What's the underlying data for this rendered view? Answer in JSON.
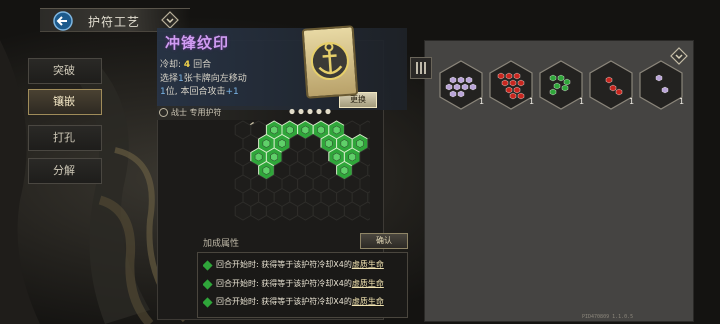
{
  "header": {
    "title": "护符工艺"
  },
  "menu": {
    "items": [
      {
        "label": "突破",
        "active": false
      },
      {
        "label": "镶嵌",
        "active": true
      },
      {
        "label": "打孔",
        "active": false
      },
      {
        "label": "分解",
        "active": false
      }
    ]
  },
  "detail": {
    "name": "冲锋纹印",
    "cooldown_label": "冷却:",
    "cooldown_value": "4",
    "cooldown_unit": "回合",
    "desc_1": "选择",
    "desc_num1": "1",
    "desc_2": "张卡牌向左移动",
    "desc_num2": "1",
    "desc_3": "位, 本回合攻击",
    "desc_num3": "+1",
    "swap_label": "更换",
    "class_label": "战士 专用护符"
  },
  "bonus": {
    "title": "加成属性",
    "confirm_label": "确认",
    "rows": [
      {
        "prefix": "回合开始时: ",
        "mid": "获得等于该护符冷却X4的",
        "link": "虚质生命"
      },
      {
        "prefix": "回合开始时: ",
        "mid": "获得等于该护符冷却X4的",
        "link": "虚质生命"
      },
      {
        "prefix": "回合开始时: ",
        "mid": "获得等于该护符冷却X4的",
        "link": "虚质生命"
      }
    ]
  },
  "inventory": {
    "slots": [
      {
        "gem": "purple-gem",
        "count": "1"
      },
      {
        "gem": "red-gem",
        "count": "1"
      },
      {
        "gem": "green-gem",
        "count": "1"
      },
      {
        "gem": "red-gem",
        "count": "1"
      },
      {
        "gem": "purple-gem",
        "count": "1"
      }
    ]
  },
  "footer": {
    "version": "PID470809 1.1.0.5"
  },
  "colors": {
    "green_gem": "#2fa63a",
    "red_gem": "#c8261f",
    "purple_gem": "#b9a4d8",
    "accent_purple": "#d09cf2",
    "accent_yellow": "#f0d24a"
  }
}
